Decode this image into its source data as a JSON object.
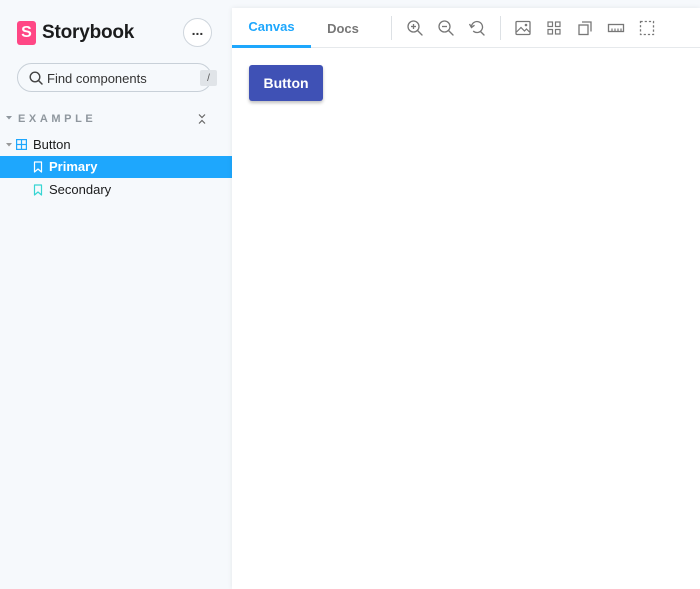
{
  "app": {
    "brand_letter": "S",
    "brand_name": "Storybook",
    "menu_dots": "...",
    "accent_color": "#1ea7fd",
    "brand_color": "#ff4785"
  },
  "sidebar": {
    "search": {
      "placeholder": "Find components",
      "shortcut": "/"
    },
    "group_label": "EXAMPLE",
    "tree": {
      "component": "Button",
      "stories": [
        {
          "label": "Primary",
          "selected": true
        },
        {
          "label": "Secondary",
          "selected": false
        }
      ]
    }
  },
  "toolbar": {
    "tabs": [
      {
        "label": "Canvas",
        "active": true
      },
      {
        "label": "Docs",
        "active": false
      }
    ],
    "tools": [
      "zoom-in-icon",
      "zoom-out-icon",
      "zoom-reset-icon",
      "background-icon",
      "grid-icon",
      "viewport-icon",
      "measure-icon",
      "outline-icon"
    ]
  },
  "preview": {
    "button_label": "Button",
    "button_color": "#3f51b5"
  }
}
